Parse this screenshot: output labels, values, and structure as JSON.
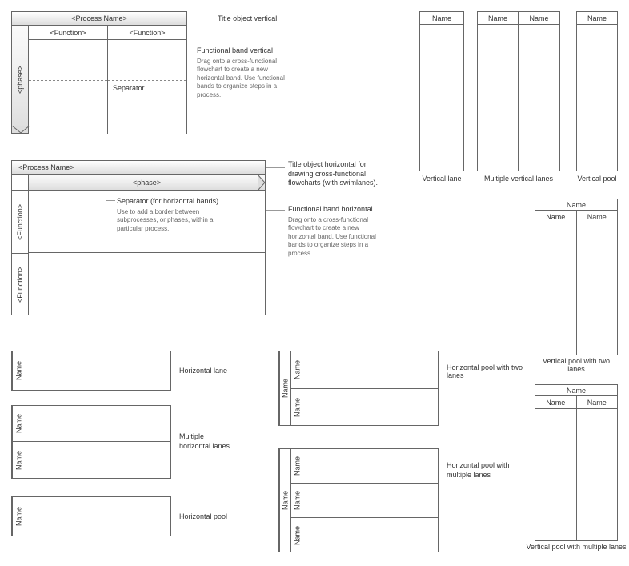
{
  "swimlane1": {
    "process_name": "<Process Name>",
    "phase": "<phase>",
    "function1": "<Function>",
    "function2": "<Function>",
    "separator": "Separator",
    "callout_title": "Title object vertical",
    "callout_band": "Functional band vertical",
    "callout_band_desc": "Drag onto a cross-functional flowchart to create a new horizontal band. Use functional bands to organize steps in a process."
  },
  "swimlane2": {
    "process_name": "<Process Name>",
    "phase": "<phase>",
    "function1": "<Function>",
    "function2": "<Function>",
    "sep_title": "Separator (for horizontal bands)",
    "sep_desc": "Use to add a border between subprocesses, or phases, within a particular process.",
    "callout_title": "Title object horizontal for drawing cross-functional flowcharts (with swimlanes).",
    "callout_band": "Functional band horizontal",
    "callout_band_desc": "Drag onto a cross-functional flowchart to create a new horizontal band. Use functional bands to organize steps in a process."
  },
  "lanes": {
    "name": "Name",
    "horizontal_lane": "Horizontal lane",
    "multiple_horizontal_lanes": "Multiple horizontal lanes",
    "horizontal_pool": "Horizontal pool",
    "horizontal_pool_two": "Horizontal pool with two lanes",
    "horizontal_pool_multi": "Horizontal pool with multiple lanes",
    "vertical_lane": "Vertical lane",
    "multiple_vertical_lanes": "Multiple vertical lanes",
    "vertical_pool": "Vertical pool",
    "vertical_pool_two": "Vertical pool with two lanes",
    "vertical_pool_multi": "Vertical pool with multiple lanes"
  }
}
